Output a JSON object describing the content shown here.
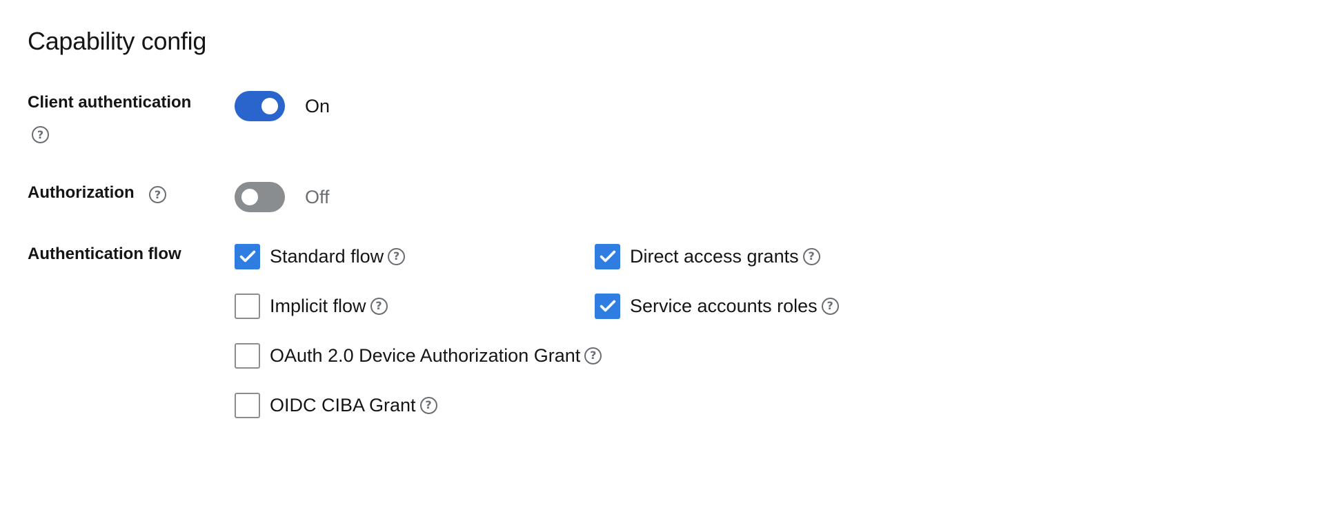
{
  "title": "Capability config",
  "client_authentication": {
    "label": "Client authentication",
    "state_text": "On",
    "enabled": true
  },
  "authorization": {
    "label": "Authorization",
    "state_text": "Off",
    "enabled": false
  },
  "authentication_flow": {
    "label": "Authentication flow",
    "options": [
      {
        "label": "Standard flow",
        "checked": true
      },
      {
        "label": "Direct access grants",
        "checked": true
      },
      {
        "label": "Implicit flow",
        "checked": false
      },
      {
        "label": "Service accounts roles",
        "checked": true
      },
      {
        "label": "OAuth 2.0 Device Authorization Grant",
        "checked": false
      },
      {
        "label": "OIDC CIBA Grant",
        "checked": false
      }
    ]
  },
  "help_glyph": "?",
  "icons": {
    "help": "help-circle-icon",
    "check": "check-icon"
  },
  "colors": {
    "switch_on": "#2965cc",
    "switch_off": "#8a8d90",
    "checkbox_checked": "#2f7de1",
    "text_primary": "#151515",
    "text_muted": "#6a6e73"
  }
}
